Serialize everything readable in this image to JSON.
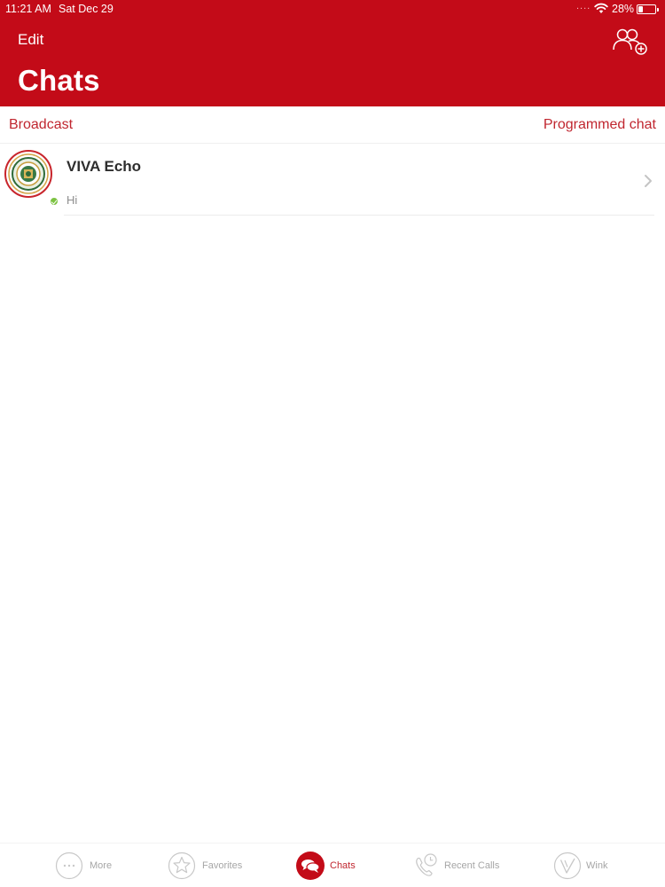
{
  "status_bar": {
    "time": "11:21 AM",
    "date": "Sat Dec 29",
    "signal_dots": "....",
    "battery_percent": "28%",
    "battery_level": 0.28,
    "wifi_icon": "wifi-icon"
  },
  "header": {
    "edit_label": "Edit",
    "title": "Chats",
    "add_group_icon": "add-contacts-icon",
    "background_color": "#c30b18"
  },
  "actions": {
    "broadcast_label": "Broadcast",
    "programmed_label": "Programmed chat",
    "accent_color": "#c0262f"
  },
  "chats": [
    {
      "name": "VIVA Echo",
      "preview": "Hi",
      "online": true
    }
  ],
  "tab_bar": {
    "tabs": [
      {
        "label": "More",
        "icon": "more-icon",
        "active": false
      },
      {
        "label": "Favorites",
        "icon": "star-icon",
        "active": false
      },
      {
        "label": "Chats",
        "icon": "chat-bubbles-icon",
        "active": true
      },
      {
        "label": "Recent Calls",
        "icon": "recent-calls-icon",
        "active": false
      },
      {
        "label": "Wink",
        "icon": "wink-icon",
        "active": false
      }
    ]
  }
}
